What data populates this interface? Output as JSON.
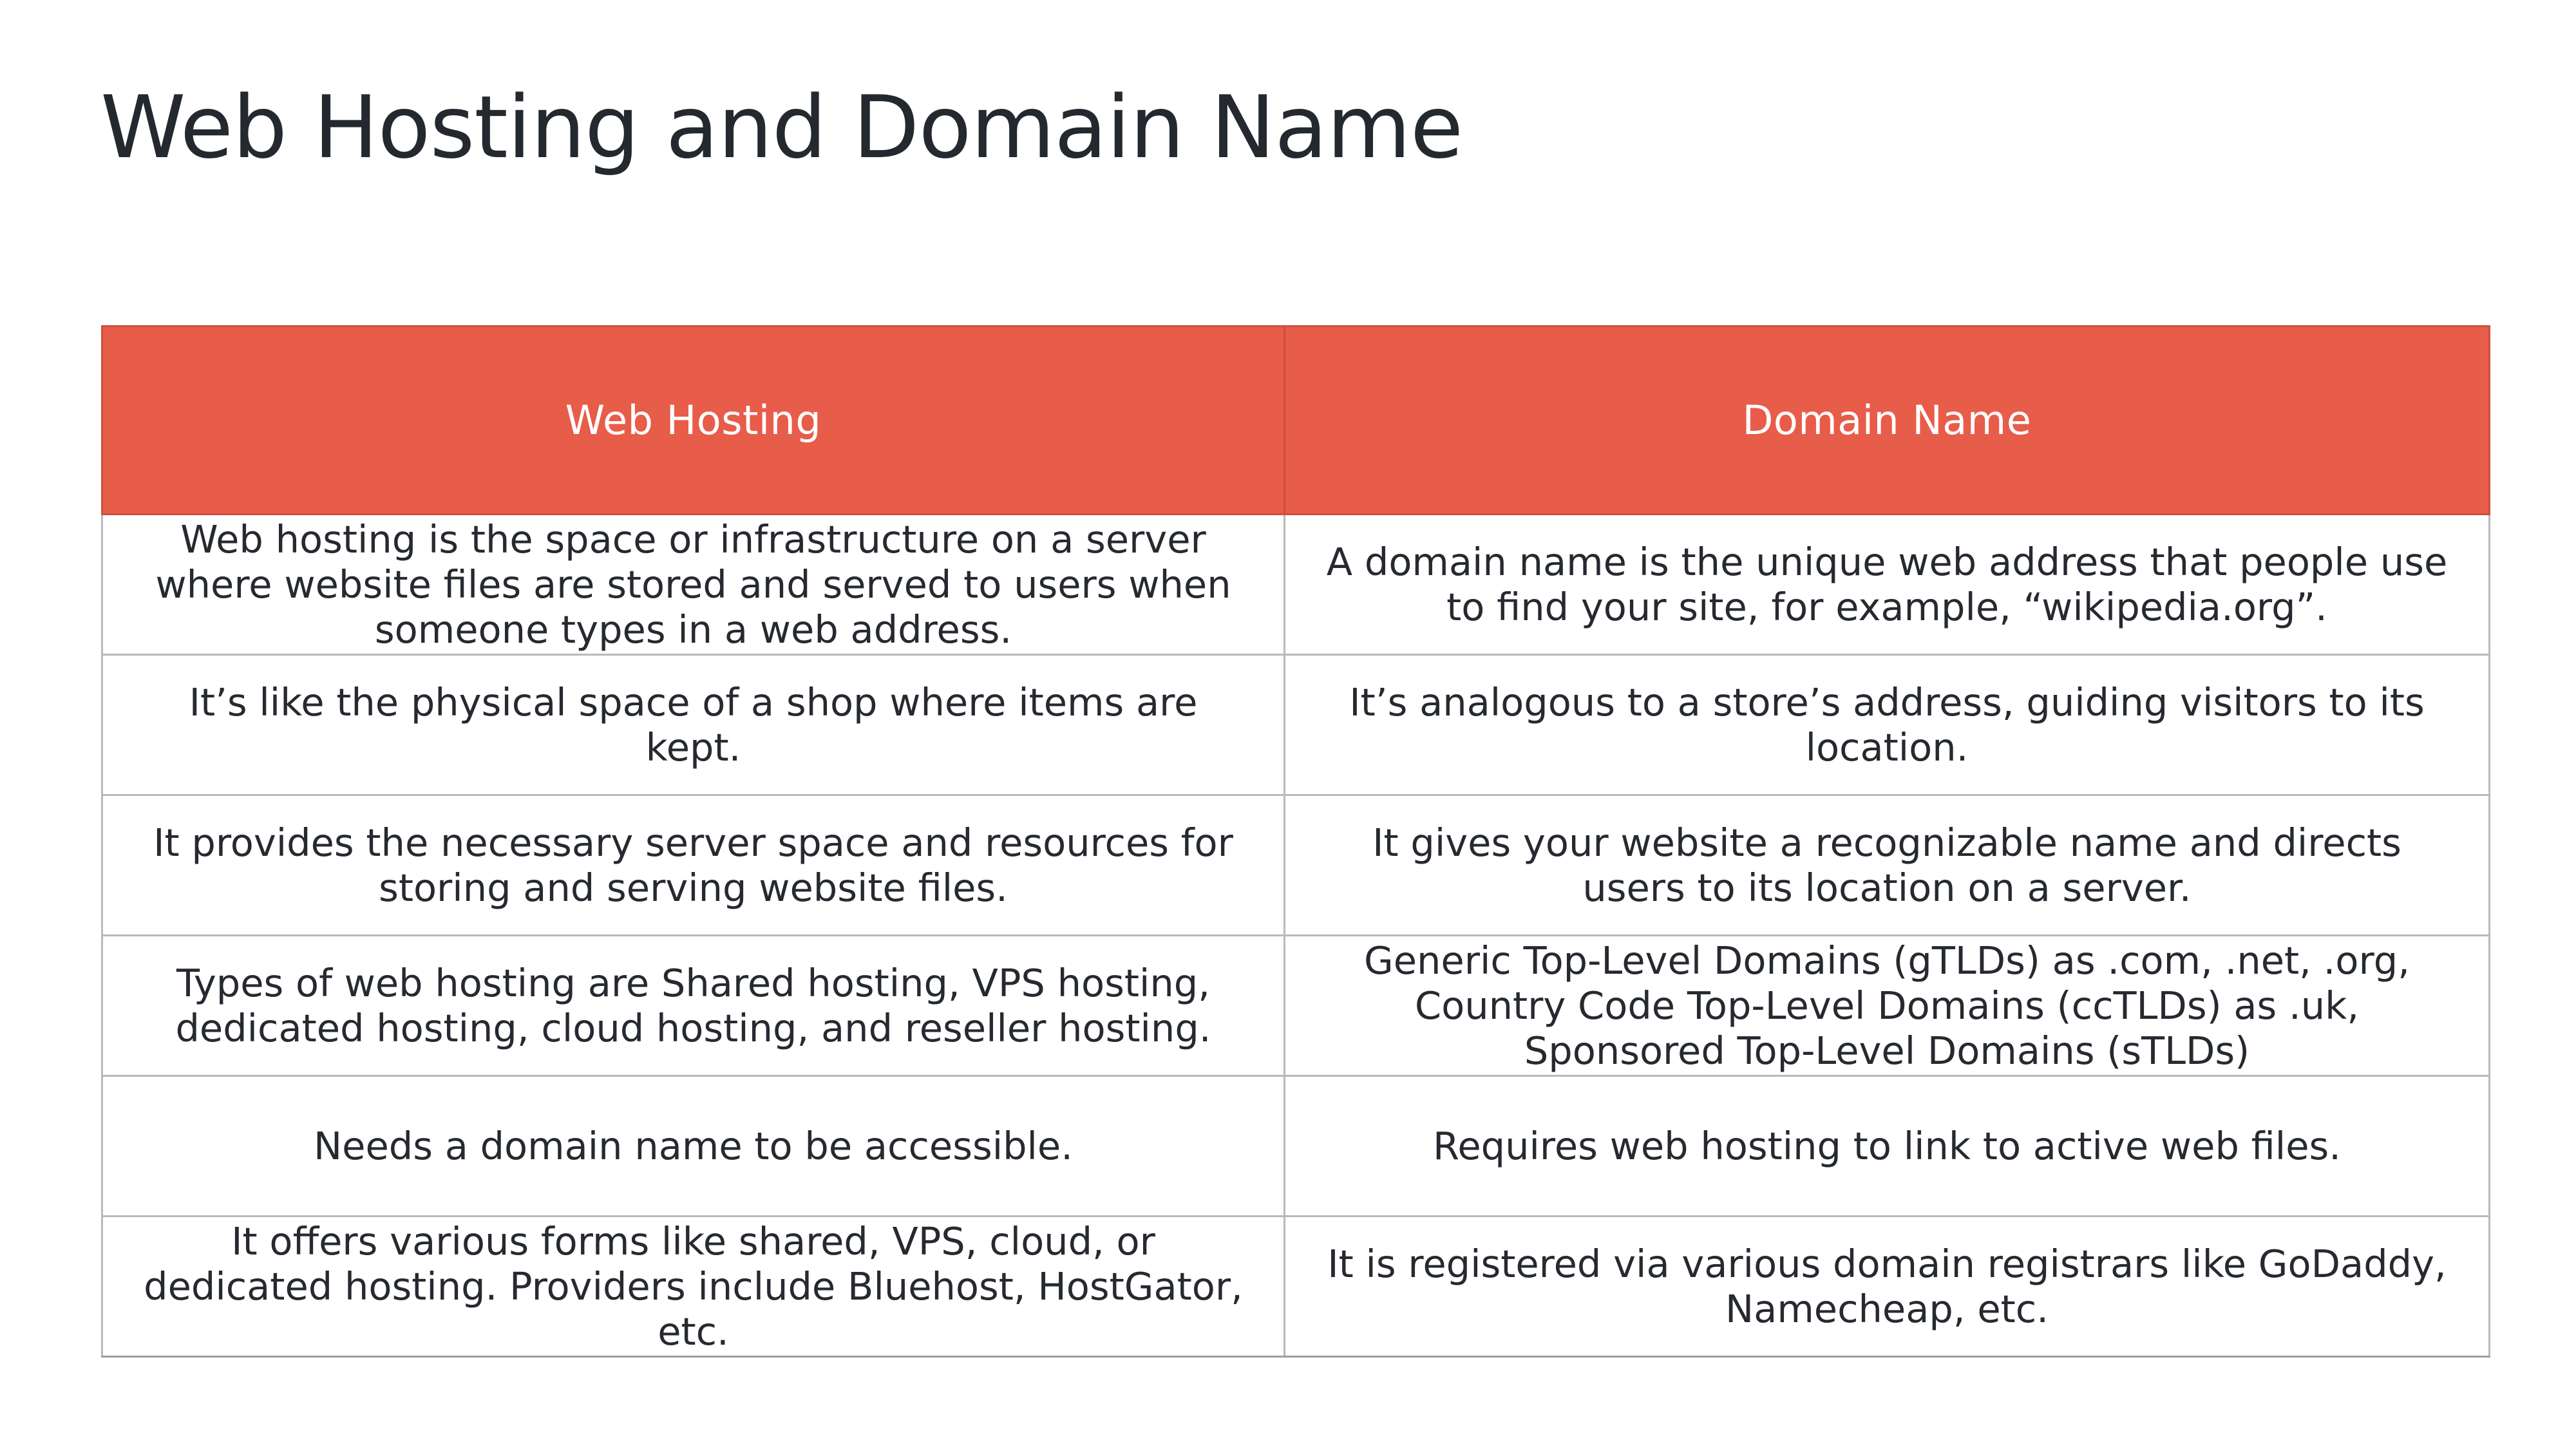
{
  "title": "Web Hosting and Domain Name",
  "table": {
    "headers": [
      "Web Hosting",
      "Domain Name"
    ],
    "rows": [
      [
        "Web hosting is the space or infrastructure on a server where website files are stored and served to users when someone types in a web address.",
        "A domain name is the unique web address that people use to find your site, for example, “wikipedia.org”."
      ],
      [
        "It’s like the physical space of a shop where items are kept.",
        "It’s analogous to a store’s address, guiding visitors to its location."
      ],
      [
        "It provides the necessary server space and resources for storing and serving website files.",
        "It gives your website a recognizable name and directs users to its location on a server."
      ],
      [
        "Types of web hosting are Shared hosting, VPS hosting, dedicated hosting, cloud hosting, and reseller hosting.",
        "Generic Top-Level Domains (gTLDs) as .com, .net, .org, Country Code Top-Level Domains (ccTLDs) as .uk, Sponsored Top-Level Domains (sTLDs)"
      ],
      [
        "Needs a domain name to be accessible.",
        "Requires web hosting to link to active web files."
      ],
      [
        "It offers various forms like shared, VPS, cloud, or dedicated hosting. Providers include Bluehost, HostGator, etc.",
        "It is registered via various domain registrars like GoDaddy, Namecheap, etc."
      ]
    ]
  },
  "colors": {
    "header_background": "#e85c4a",
    "header_text": "#ffffff",
    "body_text": "#262a30",
    "grid_line": "#b9b9b9"
  }
}
